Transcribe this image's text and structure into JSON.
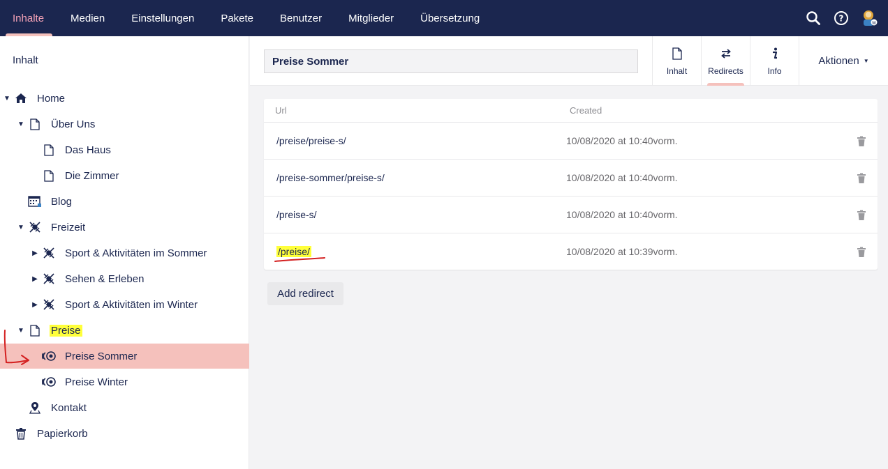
{
  "topnav": {
    "items": [
      {
        "label": "Inhalte",
        "active": true
      },
      {
        "label": "Medien"
      },
      {
        "label": "Einstellungen"
      },
      {
        "label": "Pakete"
      },
      {
        "label": "Benutzer"
      },
      {
        "label": "Mitglieder"
      },
      {
        "label": "Übersetzung"
      }
    ],
    "icons": [
      "search-icon",
      "help-icon",
      "user-avatar-icon"
    ]
  },
  "sidebar": {
    "title": "Inhalt",
    "tree": [
      {
        "label": "Home",
        "icon": "home-icon",
        "expanded": true
      },
      {
        "label": "Über Uns",
        "icon": "document-icon",
        "expanded": true
      },
      {
        "label": "Das Haus",
        "icon": "document-icon"
      },
      {
        "label": "Die Zimmer",
        "icon": "document-icon"
      },
      {
        "label": "Blog",
        "icon": "calendar-icon"
      },
      {
        "label": "Freizeit",
        "icon": "satellite-icon",
        "expanded": true
      },
      {
        "label": "Sport & Aktivitäten im Sommer",
        "icon": "satellite-icon",
        "collapsed": true
      },
      {
        "label": "Sehen & Erleben",
        "icon": "satellite-icon",
        "collapsed": true
      },
      {
        "label": "Sport & Aktivitäten im Winter",
        "icon": "satellite-icon",
        "collapsed": true
      },
      {
        "label": "Preise",
        "icon": "document-icon",
        "expanded": true,
        "highlighted": true
      },
      {
        "label": "Preise Sommer",
        "icon": "coins-icon",
        "selected": true
      },
      {
        "label": "Preise Winter",
        "icon": "coins-icon"
      },
      {
        "label": "Kontakt",
        "icon": "location-pin-icon"
      },
      {
        "label": "Papierkorb",
        "icon": "trash-icon"
      }
    ]
  },
  "editor": {
    "name_value": "Preise Sommer",
    "tabs": [
      {
        "label": "Inhalt",
        "icon": "document-icon"
      },
      {
        "label": "Redirects",
        "icon": "arrows-exchange-icon",
        "active": true
      },
      {
        "label": "Info",
        "icon": "info-icon"
      }
    ],
    "actions_label": "Aktionen"
  },
  "redirects": {
    "columns": {
      "url": "Url",
      "created": "Created"
    },
    "rows": [
      {
        "url": "/preise/preise-s/",
        "created": "10/08/2020 at 10:40vorm."
      },
      {
        "url": "/preise-sommer/preise-s/",
        "created": "10/08/2020 at 10:40vorm."
      },
      {
        "url": "/preise-s/",
        "created": "10/08/2020 at 10:40vorm."
      },
      {
        "url": "/preise/",
        "created": "10/08/2020 at 10:39vorm.",
        "highlighted": true
      }
    ],
    "add_label": "Add redirect"
  },
  "colors": {
    "header_bg": "#1b264f",
    "active_accent": "#f5c1bc",
    "highlight": "#ffff3a",
    "annotation_red": "#d42020"
  }
}
